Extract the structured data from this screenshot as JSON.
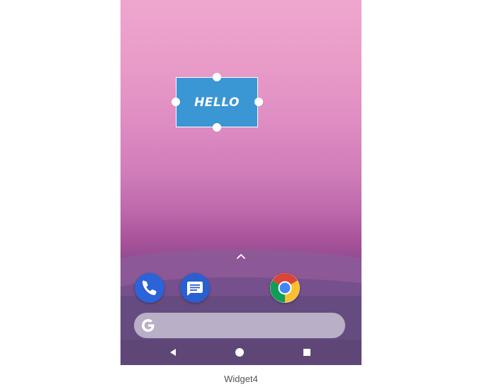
{
  "widget": {
    "text": "HELLO",
    "background_color": "#3b96d4"
  },
  "icons": {
    "drawer": "chevron-up-icon",
    "phone": "phone-icon",
    "messages": "messages-icon",
    "chrome": "chrome-icon",
    "search": "google-g-icon",
    "back": "back-triangle-icon",
    "home": "home-circle-icon",
    "recents": "recents-square-icon"
  },
  "caption": "Widget4"
}
